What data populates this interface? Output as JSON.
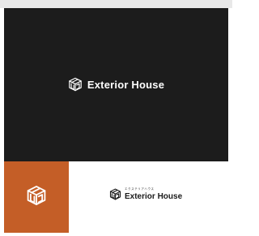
{
  "brand": {
    "name": "Exterior House",
    "kana": "エクステリアハウス",
    "logo_icon": "house-box-icon"
  },
  "colors": {
    "dark_background": "#1c1c1c",
    "accent": "#c45e27",
    "light_background": "#ffffff",
    "wordmark_light": "#ffffff",
    "wordmark_dark": "#1a1a1a"
  }
}
